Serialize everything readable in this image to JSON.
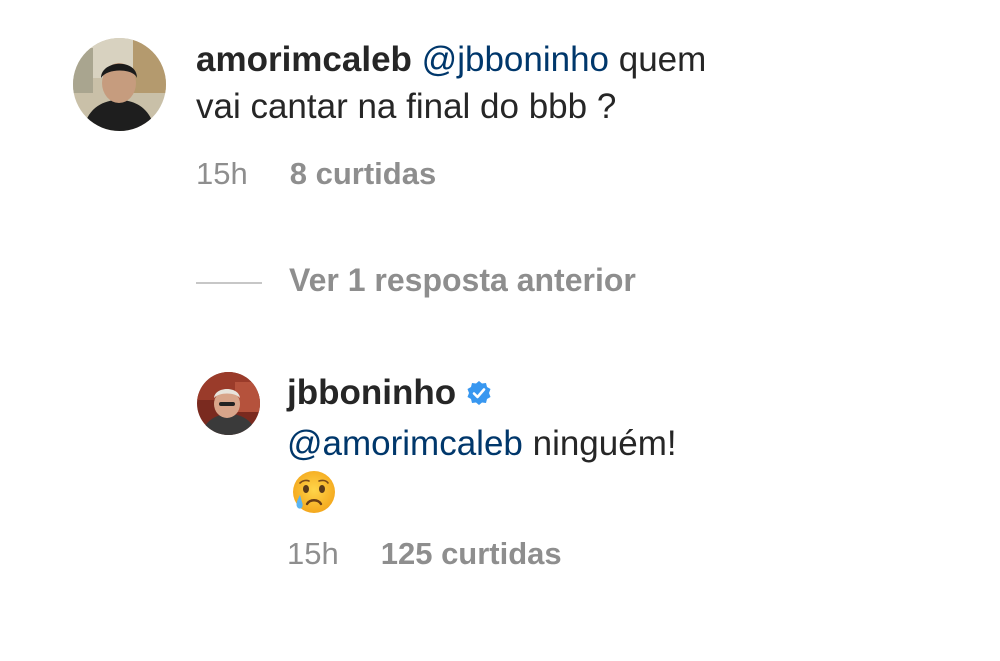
{
  "comment": {
    "username": "amorimcaleb",
    "mention": "@jbboninho",
    "text_line1_rest": " quem",
    "text_line2": "vai cantar na final do bbb ?",
    "time": "15h",
    "likes": "8 curtidas",
    "avatar_icon": "user-avatar-photo"
  },
  "thread": {
    "view_replies_label": "Ver 1 resposta anterior"
  },
  "reply": {
    "username": "jbboninho",
    "verified_icon": "verified-badge-icon",
    "mention": "@amorimcaleb",
    "text_rest": " ninguém!",
    "emoji": "crying-face-emoji",
    "time": "15h",
    "likes": "125 curtidas",
    "avatar_icon": "user-avatar-photo"
  },
  "colors": {
    "text": "#262626",
    "mention": "#00376b",
    "meta": "#8e8e8e",
    "verified": "#3897f0"
  }
}
